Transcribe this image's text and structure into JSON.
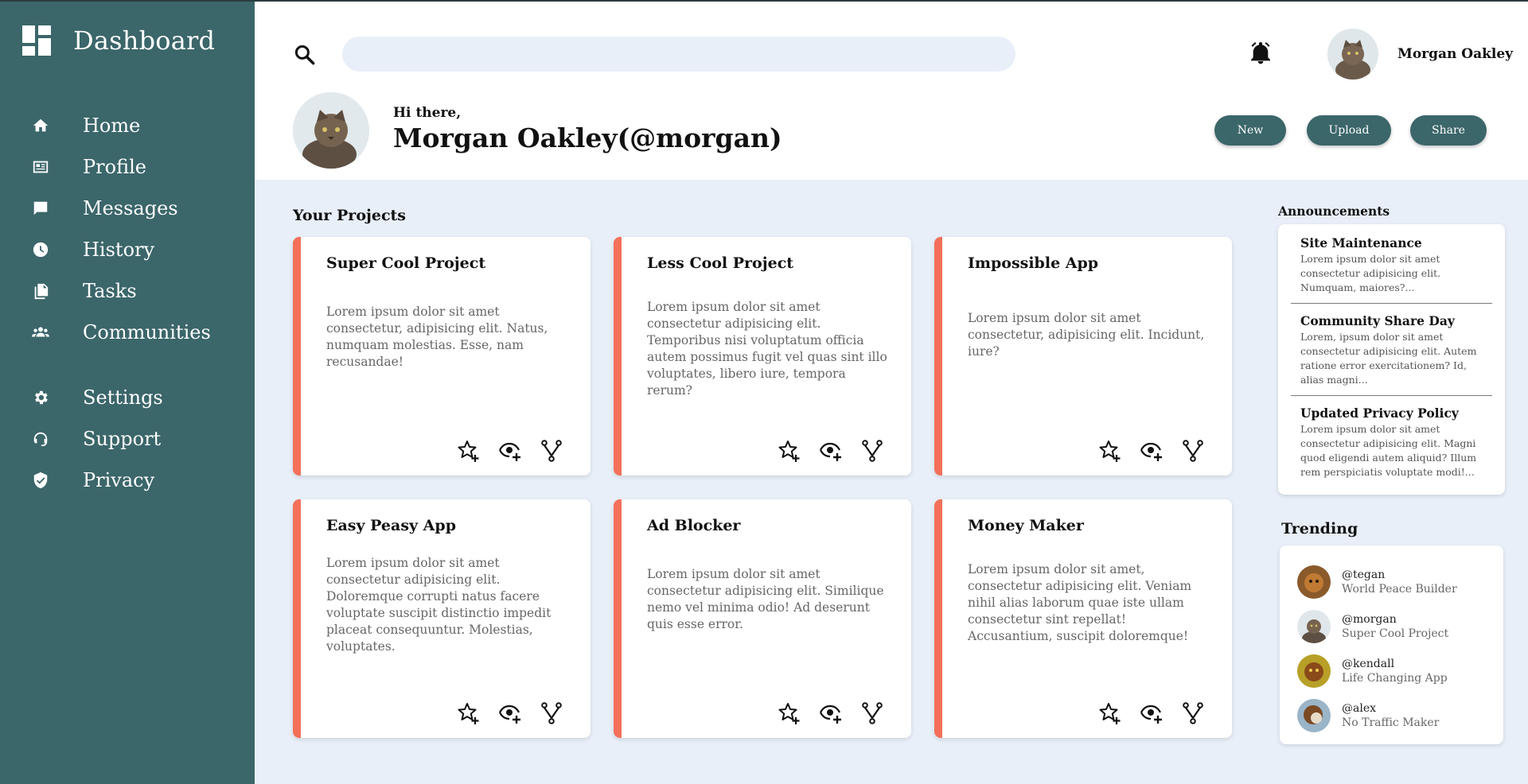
{
  "sidebar": {
    "title": "Dashboard",
    "items": [
      {
        "label": "Home",
        "icon": "home-icon"
      },
      {
        "label": "Profile",
        "icon": "id-card-icon"
      },
      {
        "label": "Messages",
        "icon": "chat-icon"
      },
      {
        "label": "History",
        "icon": "clock-icon"
      },
      {
        "label": "Tasks",
        "icon": "documents-icon"
      },
      {
        "label": "Communities",
        "icon": "people-icon"
      }
    ],
    "secondary_items": [
      {
        "label": "Settings",
        "icon": "gear-icon"
      },
      {
        "label": "Support",
        "icon": "support-icon"
      },
      {
        "label": "Privacy",
        "icon": "shield-icon"
      }
    ]
  },
  "header": {
    "search_placeholder": "",
    "user_name": "Morgan Oakley",
    "greeting": "Hi there,",
    "hero_name": "Morgan Oakley(@morgan)",
    "buttons": {
      "new": "New",
      "upload": "Upload",
      "share": "Share"
    }
  },
  "projects": {
    "section_title": "Your Projects",
    "cards": [
      {
        "title": "Super Cool Project",
        "description": "Lorem ipsum dolor sit amet consectetur, adipisicing elit. Natus, numquam molestias. Esse, nam recusandae!"
      },
      {
        "title": "Less Cool Project",
        "description": "Lorem ipsum dolor sit amet consectetur adipisicing elit. Temporibus nisi voluptatum officia autem possimus fugit vel quas sint illo voluptates, libero iure, tempora rerum?"
      },
      {
        "title": "Impossible App",
        "description": "Lorem ipsum dolor sit amet consectetur, adipisicing elit. Incidunt, iure?"
      },
      {
        "title": "Easy Peasy App",
        "description": "Lorem ipsum dolor sit amet consectetur adipisicing elit. Doloremque corrupti natus facere voluptate suscipit distinctio impedit placeat consequuntur. Molestias, voluptates."
      },
      {
        "title": "Ad Blocker",
        "description": "Lorem ipsum dolor sit amet consectetur adipisicing elit. Similique nemo vel minima odio! Ad deserunt quis esse error."
      },
      {
        "title": "Money Maker",
        "description": "Lorem ipsum dolor sit amet, consectetur adipisicing elit. Veniam nihil alias laborum quae iste ullam consectetur sint repellat! Accusantium, suscipit doloremque!"
      }
    ]
  },
  "announcements": {
    "title": "Announcements",
    "items": [
      {
        "title": "Site Maintenance",
        "text": "Lorem ipsum dolor sit amet consectetur adipisicing elit. Numquam, maiores?..."
      },
      {
        "title": "Community Share Day",
        "text": "Lorem, ipsum dolor sit amet consectetur adipisicing elit. Autem ratione error exercitationem? Id, alias magni..."
      },
      {
        "title": "Updated Privacy Policy",
        "text": "Lorem ipsum dolor sit amet consectetur adipisicing elit. Magni quod eligendi autem aliquid? Illum rem perspiciatis voluptate modi!..."
      }
    ]
  },
  "trending": {
    "title": "Trending",
    "items": [
      {
        "handle": "@tegan",
        "project": "World Peace Builder"
      },
      {
        "handle": "@morgan",
        "project": "Super Cool Project"
      },
      {
        "handle": "@kendall",
        "project": "Life Changing App"
      },
      {
        "handle": "@alex",
        "project": "No Traffic Maker"
      }
    ]
  },
  "colors": {
    "sidebar": "#3b666a",
    "accent": "#f4705a",
    "background": "#e8eff8"
  }
}
